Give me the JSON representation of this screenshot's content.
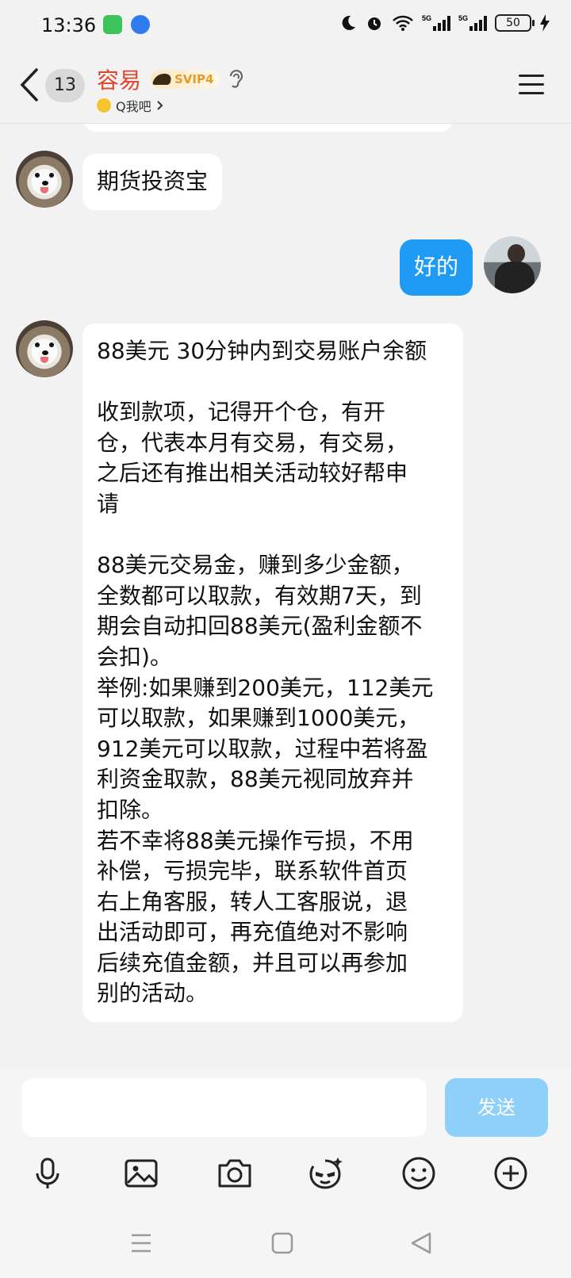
{
  "status_bar": {
    "time": "13:36",
    "battery": "50",
    "network": "5G"
  },
  "header": {
    "unread_count": "13",
    "title": "容易",
    "vip_badge": "SVIP4",
    "subtitle": "Q我吧",
    "icons": [
      "back-arrow-icon",
      "ear-icon",
      "menu-icon"
    ]
  },
  "messages": [
    {
      "sender": "other",
      "lines": [
        "期货投资宝"
      ]
    },
    {
      "sender": "me",
      "lines": [
        "好的"
      ]
    },
    {
      "sender": "other",
      "lines": [
        "88美元 30分钟内到交易账户余额",
        "",
        "收到款项，记得开个仓，有开",
        "仓，代表本月有交易，有交易，",
        "之后还有推出相关活动较好帮申",
        "请",
        "",
        "88美元交易金，赚到多少金额，",
        "全数都可以取款，有效期7天，到",
        "期会自动扣回88美元(盈利金额不",
        "会扣)。",
        "举例:如果赚到200美元，112美元",
        "可以取款，如果赚到1000美元，",
        "912美元可以取款，过程中若将盈",
        "利资金取款，88美元视同放弃并",
        "扣除。",
        "若不幸将88美元操作亏损，不用",
        "补偿，亏损完毕，联系软件首页",
        "右上角客服，转人工客服说，退",
        "出活动即可，再充值绝对不影响",
        "后续充值金额，并且可以再参加",
        "别的活动。"
      ]
    }
  ],
  "composer": {
    "send_label": "发送"
  },
  "toolbar": [
    "microphone-icon",
    "image-icon",
    "camera-icon",
    "sticker-icon",
    "emoji-icon",
    "plus-icon"
  ],
  "nav_bar": [
    "recents-icon",
    "home-icon",
    "back-icon"
  ],
  "colors": {
    "accent": "#1f9bf5",
    "title": "#e1432b",
    "send_disabled": "#8fd0fb"
  }
}
